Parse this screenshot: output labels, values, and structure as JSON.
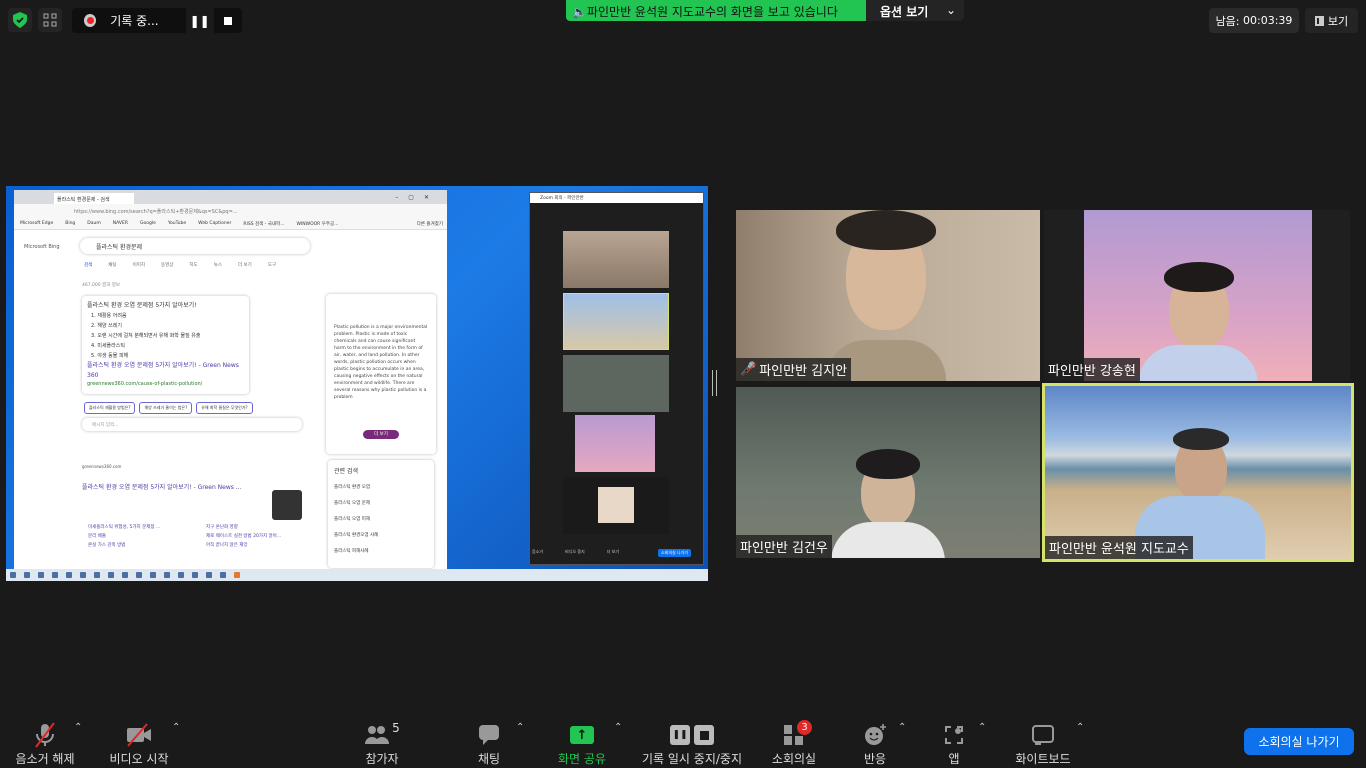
{
  "topbar": {
    "recording_label": "기록 중...",
    "banner_text": "파인만반 윤석원 지도교수의 화면을 보고 있습니다",
    "options_label": "옵션 보기",
    "timer_label": "남음:",
    "timer_value": "00:03:39",
    "view_label": "보기"
  },
  "shared_screen": {
    "browser": {
      "tab_title": "플라스틱 환경문제 - 검색",
      "url": "https://www.bing.com/search?q=플라스틱+환경문제&qs=SC&pq=...",
      "bookmarks": [
        "Microsoft Edge",
        "Bing",
        "Daum",
        "NAVER",
        "Google",
        "YouTube",
        "Web Captioner",
        "RISS 검색 - 국내학...",
        "WINWOOR 우주공...",
        "다른 즐겨찾기"
      ],
      "bing_logo": "Microsoft Bing",
      "search_query": "플라스틱 환경문제",
      "search_tabs": [
        "검색",
        "채팅",
        "이미지",
        "동영상",
        "지도",
        "뉴스",
        "더 보기",
        "도구"
      ],
      "result_count": "467,000 결과 정보",
      "answer_title": "플라스틱 환경 오염 문제점 5가지 알아보기!",
      "answer_items": [
        "1. 재활용 어려움",
        "2. 해양 쓰레기",
        "3. 오랜 시간에 걸쳐 분해되면서 유해 화학 물질 유출",
        "4. 미세플라스틱",
        "5. 야생 동물 피해"
      ],
      "answer_link": "플라스틱 환경 오염 문제점 5가지 알아보기! - Green News 360",
      "answer_url": "greennews360.com/cause-of-plastic-pollution/",
      "suggestions": [
        "플라스틱 재활용 방법은?",
        "해양 쓰레기 줄이는 법은?",
        "유해 화학 물질은 무엇인가?"
      ],
      "message_placeholder": "메시지 입력...",
      "result2_site": "greennews360.com",
      "result2_title": "플라스틱 환경 오염 문제점 5가지 알아보기! - Green News ...",
      "sublinks": [
        "미세플라스틱 위험성, 5가지 문제점 ...",
        "지구 온난화 영향",
        "분리 배출",
        "제로 웨이스트 실천 방법 20가지 알아...",
        "온실 가스 감축 방법",
        "아직 끝나지 않은 재앙"
      ],
      "chat_text": "Plastic pollution is a major environmental problem. Plastic is made of toxic chemicals and can cause significant harm to the environment in the form of air, water, and land pollution. In other words, plastic pollution occurs when plastic begins to accumulate in an area, causing negative effects on the natural environment and wildlife. There are several reasons why plastic pollution is a problem",
      "more_label": "더 보기",
      "related_title": "관련 검색",
      "related": [
        "플라스틱 환경 오염",
        "플라스틱 오염 문제",
        "플라스틱 오염 피해",
        "플라스틱 환경오염 사례",
        "플라스틱 피해사례"
      ]
    },
    "zoom_mini": {
      "title": "Zoom 회의 - 파인만반",
      "leave": "소회의실 나가기",
      "controls": [
        "음소거",
        "비디오 중지",
        "더 보기"
      ]
    }
  },
  "participants": [
    {
      "name": "파인만반 김지안",
      "muted": true
    },
    {
      "name": "파인만반 강송현",
      "muted": false
    },
    {
      "name": "파인만반 김건우",
      "muted": false
    },
    {
      "name": "파인만반 윤석원 지도교수",
      "muted": false,
      "active": true
    }
  ],
  "toolbar": {
    "unmute": "음소거 해제",
    "start_video": "비디오 시작",
    "participants": "참가자",
    "participant_count": "5",
    "chat": "채팅",
    "share": "화면 공유",
    "record": "기록 일시 중지/중지",
    "breakout": "소회의실",
    "breakout_badge": "3",
    "reactions": "반응",
    "apps": "앱",
    "whiteboard": "화이트보드",
    "leave_breakout": "소회의실 나가기"
  },
  "colors": {
    "green": "#23c552",
    "blue": "#0e72ed",
    "active_border": "#d5e36b",
    "badge": "#e02828"
  }
}
